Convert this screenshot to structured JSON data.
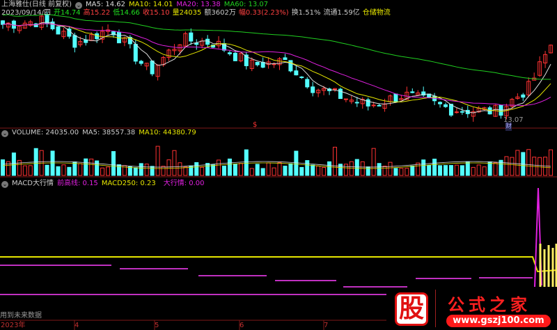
{
  "header": {
    "stock_name": "上海雅仕(日线 前复权)",
    "ma": [
      {
        "label": "MA5: 14.62",
        "color": "#dddddd"
      },
      {
        "label": "MA10: 14.01",
        "color": "#e6e600"
      },
      {
        "label": "MA20: 13.38",
        "color": "#e020e0"
      },
      {
        "label": "MA60: 13.07",
        "color": "#20d020"
      }
    ],
    "quote": [
      {
        "text": "2023/09/14/四",
        "color": "#cccccc"
      },
      {
        "text": "开14.74",
        "color": "#20e020"
      },
      {
        "text": "高15.22",
        "color": "#ff4040"
      },
      {
        "text": "低14.66",
        "color": "#20e020"
      },
      {
        "text": "收15.10",
        "color": "#ff4040"
      },
      {
        "text": "量24035",
        "color": "#e6e600"
      },
      {
        "text": "额3602万",
        "color": "#cccccc"
      },
      {
        "text": "幅0.33(2.23%)",
        "color": "#ff4040"
      },
      {
        "text": "换1.51%",
        "color": "#cccccc"
      },
      {
        "text": "流通1.59亿",
        "color": "#cccccc"
      },
      {
        "text": "仓储物流",
        "color": "#e6e600"
      }
    ],
    "low_marker": "13.07",
    "finance_badge": "财",
    "dollar_marker": "$"
  },
  "volume": {
    "label": "VOLUME: 24035.00",
    "ma5": "MA5: 38557.38",
    "ma10": "MA10: 44380.79"
  },
  "macd": {
    "label": "MACD大行情",
    "prev_high": "前高线: 0.15",
    "macd250": "MACD250: 0.23",
    "big": "大行情: 0.00"
  },
  "footer": {
    "note": "用到未来数据",
    "dates": [
      "2023年",
      "4",
      "5",
      "6",
      "7"
    ]
  },
  "logo": {
    "char": "股",
    "name": "公式之家",
    "url": "www.gszj100.com"
  },
  "colors": {
    "up": "#ff3232",
    "down": "#54ffff",
    "ma5": "#dddddd",
    "ma10": "#e6e600",
    "ma20": "#e020e0",
    "ma60": "#20d020"
  }
}
